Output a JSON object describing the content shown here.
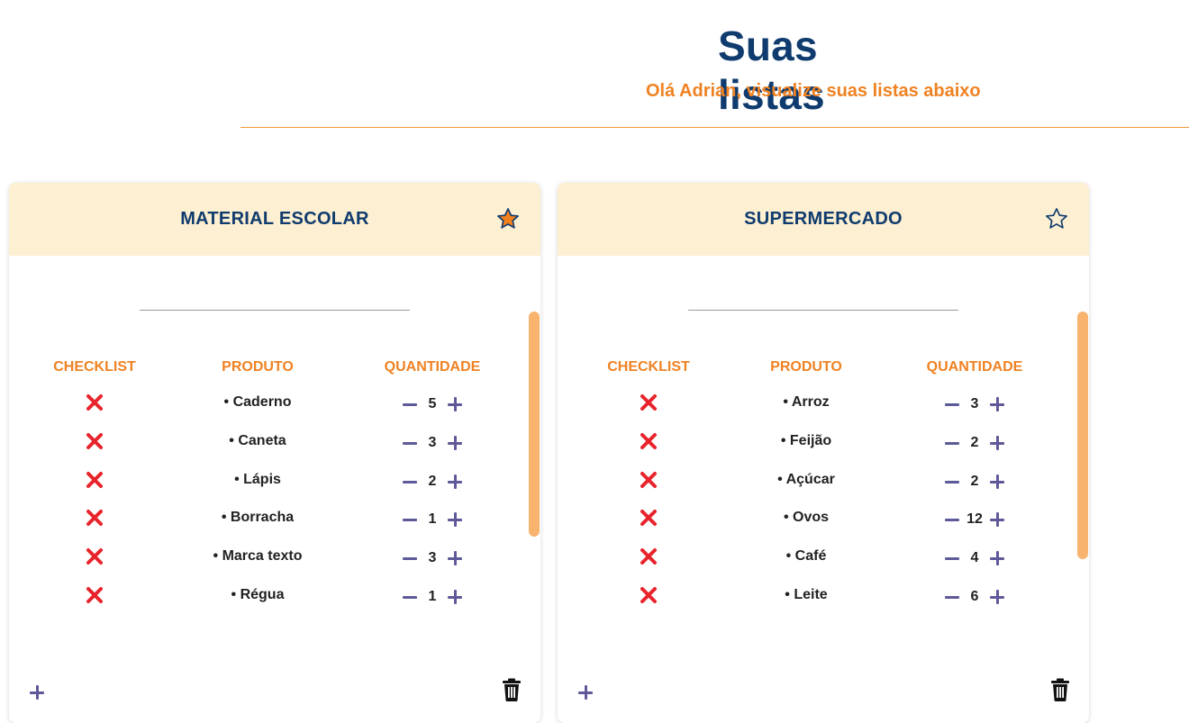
{
  "header": {
    "title": "Suas listas",
    "subtitle": "Olá Adrian, visualize suas listas abaixo"
  },
  "colors": {
    "title": "#0f3b6e",
    "accent": "#ef8222",
    "card_header_bg": "#fdefd1",
    "control": "#5e5a99",
    "remove": "#e8232b"
  },
  "lists": [
    {
      "name": "MATERIAL ESCOLAR",
      "favorite": true,
      "columns": {
        "checklist": "CHECKLIST",
        "product": "PRODUTO",
        "quantity": "QUANTIDADE"
      },
      "items": [
        {
          "product": "• Caderno",
          "qty": "5"
        },
        {
          "product": "• Caneta",
          "qty": "3"
        },
        {
          "product": "• Lápis",
          "qty": "2"
        },
        {
          "product": "• Borracha",
          "qty": "1"
        },
        {
          "product": "• Marca texto",
          "qty": "3"
        },
        {
          "product": "• Régua",
          "qty": "1"
        }
      ]
    },
    {
      "name": "SUPERMERCADO",
      "favorite": false,
      "columns": {
        "checklist": "CHECKLIST",
        "product": "PRODUTO",
        "quantity": "QUANTIDADE"
      },
      "items": [
        {
          "product": "• Arroz",
          "qty": "3"
        },
        {
          "product": "• Feijão",
          "qty": "2"
        },
        {
          "product": "• Açúcar",
          "qty": "2"
        },
        {
          "product": "• Ovos",
          "qty": "12"
        },
        {
          "product": "• Café",
          "qty": "4"
        },
        {
          "product": "• Leite",
          "qty": "6"
        }
      ]
    }
  ],
  "icons": {
    "favorite": "star-icon",
    "remove": "x-icon",
    "decrement": "minus-icon",
    "increment": "plus-icon",
    "add_item": "plus-icon",
    "delete_list": "trash-icon"
  }
}
